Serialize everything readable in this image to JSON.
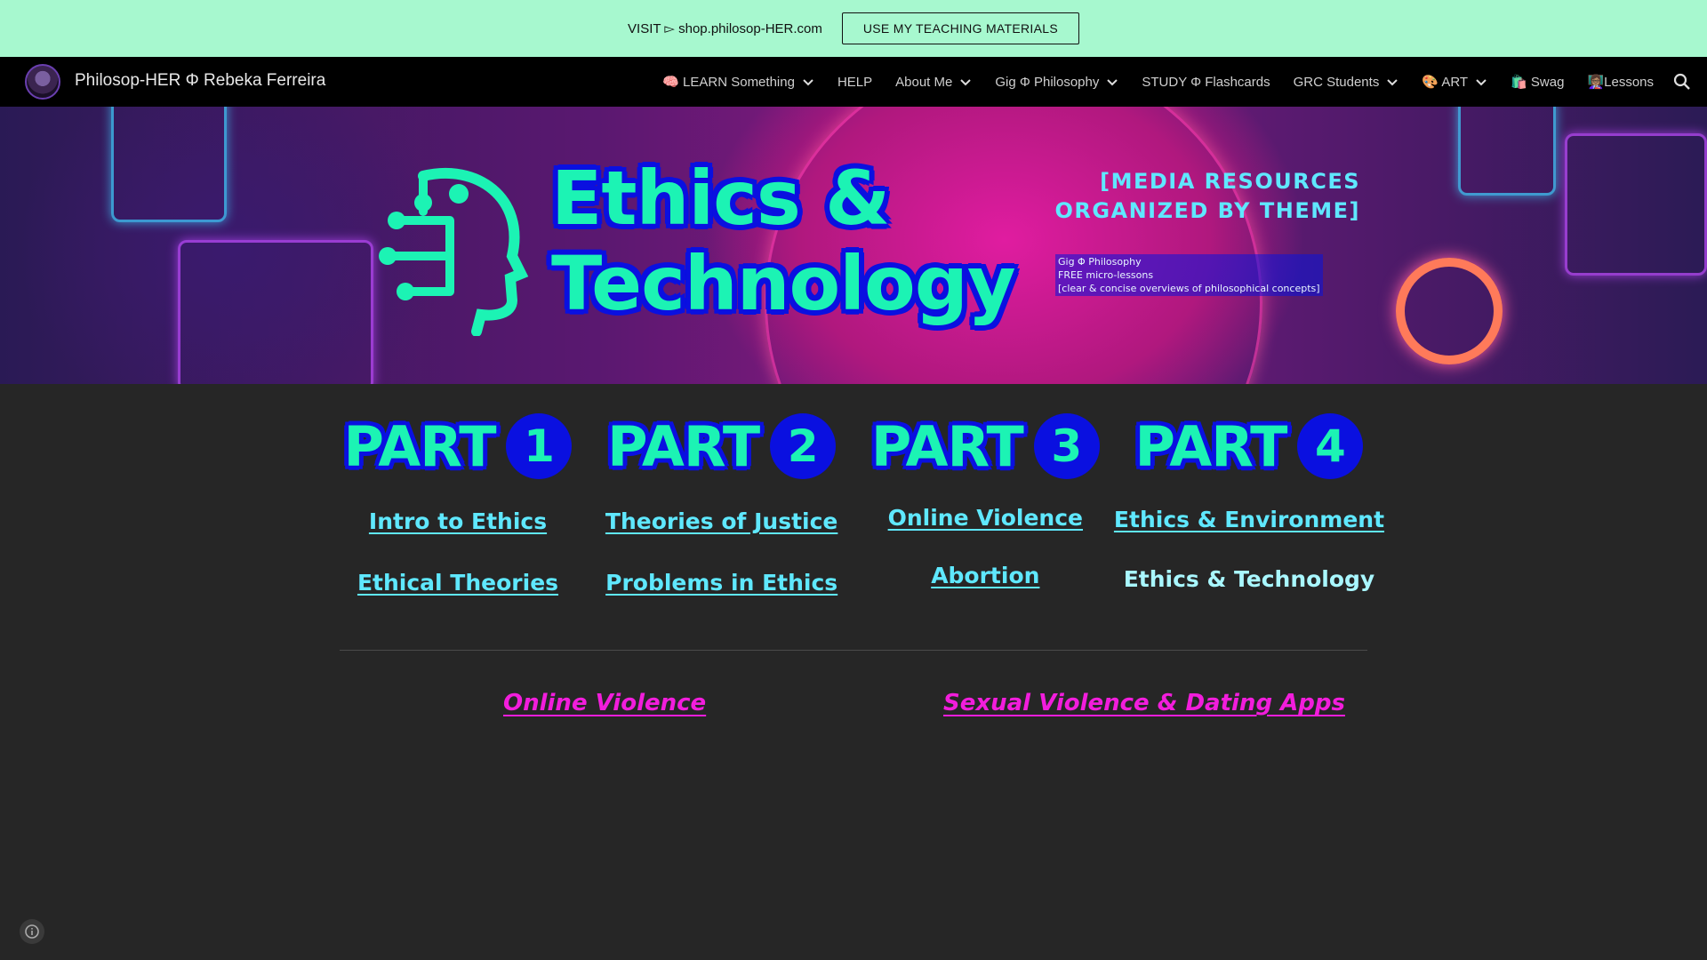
{
  "announcement": {
    "text": "VISIT ▻ shop.philosop-HER.com",
    "button_label": "USE MY TEACHING MATERIALS"
  },
  "nav": {
    "site_title": "Philosop-HER Φ Rebeka Ferreira",
    "items": [
      {
        "label": "🧠 LEARN Something",
        "dropdown": true
      },
      {
        "label": "HELP",
        "dropdown": false
      },
      {
        "label": "About Me",
        "dropdown": true
      },
      {
        "label": "Gig Φ Philosophy",
        "dropdown": true
      },
      {
        "label": "STUDY Φ Flashcards",
        "dropdown": false
      },
      {
        "label": "GRC Students",
        "dropdown": true
      },
      {
        "label": "🎨 ART",
        "dropdown": true
      },
      {
        "label": "🛍️ Swag",
        "dropdown": false
      },
      {
        "label": "👩🏽‍🏫Lessons",
        "dropdown": false
      }
    ],
    "search_icon": "search-icon"
  },
  "banner": {
    "title_line1": "Ethics &",
    "title_line2": "Technology",
    "subtitle_line1": "[MEDIA RESOURCES",
    "subtitle_line2": "ORGANIZED BY THEME]",
    "small_line1": "Gig Φ Philosophy",
    "small_line2": "FREE micro-lessons",
    "small_line3": "[clear & concise overviews of philosophical concepts]"
  },
  "parts": [
    {
      "word": "PART",
      "number": "1",
      "link1": "Intro to Ethics",
      "link2": "Ethical Theories"
    },
    {
      "word": "PART",
      "number": "2",
      "link1": "Theories of Justice",
      "link2": "Problems in Ethics"
    },
    {
      "word": "PART",
      "number": "3",
      "link1": "Online Violence",
      "link2": "Abortion"
    },
    {
      "word": "PART",
      "number": "4",
      "link1": "Ethics & Environment",
      "link2": "Ethics & Technology"
    }
  ],
  "bottom_links": {
    "left": "Online Violence",
    "right": "Sexual Violence & Dating Apps"
  },
  "colors": {
    "announce_bg": "#a7f8cf",
    "nav_bg": "#000000",
    "page_bg": "#262626",
    "accent_teal": "#1cf3b4",
    "accent_blue": "#0a10e0",
    "link_cyan": "#5fe8ff",
    "link_magenta": "#f21ddc"
  }
}
